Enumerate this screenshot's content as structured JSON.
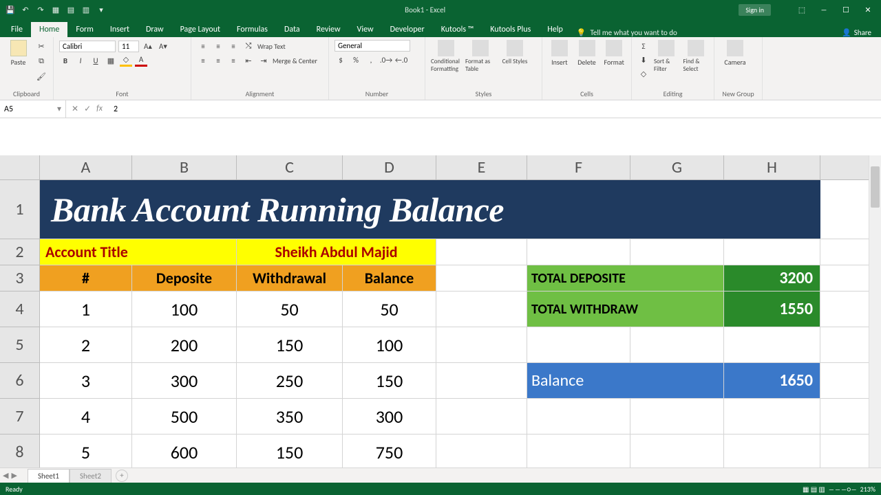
{
  "app": {
    "title": "Book1 - Excel",
    "signin": "Sign in",
    "share": "Share"
  },
  "tabs": [
    "File",
    "Home",
    "Form",
    "Insert",
    "Draw",
    "Page Layout",
    "Formulas",
    "Data",
    "Review",
    "View",
    "Developer",
    "Kutools ™",
    "Kutools Plus",
    "Help"
  ],
  "tellme": "Tell me what you want to do",
  "ribbon": {
    "clipboard": "Clipboard",
    "paste": "Paste",
    "font": "Font",
    "fontname": "Calibri",
    "fontsize": "11",
    "alignment": "Alignment",
    "wrap": "Wrap Text",
    "merge": "Merge & Center",
    "number": "Number",
    "numfmt": "General",
    "styles": "Styles",
    "cond": "Conditional Formatting",
    "fmtTable": "Format as Table",
    "cellStyles": "Cell Styles",
    "cells": "Cells",
    "insert": "Insert",
    "delete": "Delete",
    "format": "Format",
    "editing": "Editing",
    "sortfilter": "Sort & Filter",
    "findselect": "Find & Select",
    "newgroup": "New Group",
    "camera": "Camera"
  },
  "fbar": {
    "name": "A5",
    "value": "2"
  },
  "chart_data": {
    "type": "table",
    "title": "Bank Account Running Balance",
    "account_title_label": "Account Title",
    "account_title_value": "Sheikh Abdul Majid",
    "columns": [
      "#",
      "Deposite",
      "Withdrawal",
      "Balance"
    ],
    "rows": [
      [
        1,
        100,
        50,
        50
      ],
      [
        2,
        200,
        150,
        100
      ],
      [
        3,
        300,
        250,
        150
      ],
      [
        4,
        500,
        350,
        300
      ],
      [
        5,
        600,
        150,
        750
      ]
    ],
    "summary": {
      "total_deposite_label": "TOTAL DEPOSITE",
      "total_deposite": 3200,
      "total_withdraw_label": "TOTAL WITHDRAW",
      "total_withdraw": 1550,
      "balance_label": "Balance",
      "balance": 1650
    }
  },
  "cols": [
    "A",
    "B",
    "C",
    "D",
    "E",
    "F",
    "G",
    "H"
  ],
  "rownums": [
    "1",
    "2",
    "3",
    "4",
    "5",
    "6",
    "7",
    "8"
  ],
  "sheets": {
    "active": "Sheet1",
    "other": "Sheet2"
  },
  "status": {
    "ready": "Ready",
    "zoom": "213%"
  }
}
